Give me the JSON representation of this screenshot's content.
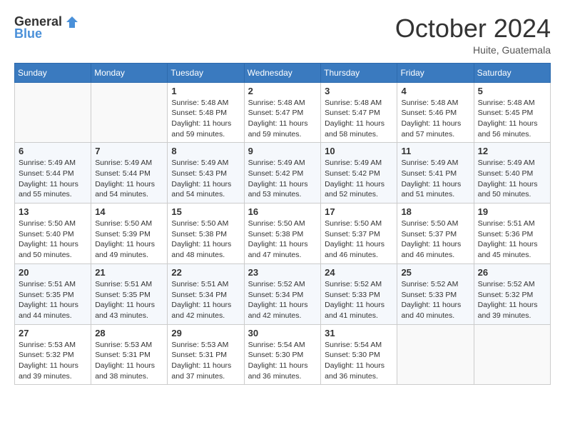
{
  "header": {
    "logo_general": "General",
    "logo_blue": "Blue",
    "month_title": "October 2024",
    "location": "Huite, Guatemala"
  },
  "weekdays": [
    "Sunday",
    "Monday",
    "Tuesday",
    "Wednesday",
    "Thursday",
    "Friday",
    "Saturday"
  ],
  "weeks": [
    [
      {
        "day": "",
        "info": ""
      },
      {
        "day": "",
        "info": ""
      },
      {
        "day": "1",
        "info": "Sunrise: 5:48 AM\nSunset: 5:48 PM\nDaylight: 11 hours and 59 minutes."
      },
      {
        "day": "2",
        "info": "Sunrise: 5:48 AM\nSunset: 5:47 PM\nDaylight: 11 hours and 59 minutes."
      },
      {
        "day": "3",
        "info": "Sunrise: 5:48 AM\nSunset: 5:47 PM\nDaylight: 11 hours and 58 minutes."
      },
      {
        "day": "4",
        "info": "Sunrise: 5:48 AM\nSunset: 5:46 PM\nDaylight: 11 hours and 57 minutes."
      },
      {
        "day": "5",
        "info": "Sunrise: 5:48 AM\nSunset: 5:45 PM\nDaylight: 11 hours and 56 minutes."
      }
    ],
    [
      {
        "day": "6",
        "info": "Sunrise: 5:49 AM\nSunset: 5:44 PM\nDaylight: 11 hours and 55 minutes."
      },
      {
        "day": "7",
        "info": "Sunrise: 5:49 AM\nSunset: 5:44 PM\nDaylight: 11 hours and 54 minutes."
      },
      {
        "day": "8",
        "info": "Sunrise: 5:49 AM\nSunset: 5:43 PM\nDaylight: 11 hours and 54 minutes."
      },
      {
        "day": "9",
        "info": "Sunrise: 5:49 AM\nSunset: 5:42 PM\nDaylight: 11 hours and 53 minutes."
      },
      {
        "day": "10",
        "info": "Sunrise: 5:49 AM\nSunset: 5:42 PM\nDaylight: 11 hours and 52 minutes."
      },
      {
        "day": "11",
        "info": "Sunrise: 5:49 AM\nSunset: 5:41 PM\nDaylight: 11 hours and 51 minutes."
      },
      {
        "day": "12",
        "info": "Sunrise: 5:49 AM\nSunset: 5:40 PM\nDaylight: 11 hours and 50 minutes."
      }
    ],
    [
      {
        "day": "13",
        "info": "Sunrise: 5:50 AM\nSunset: 5:40 PM\nDaylight: 11 hours and 50 minutes."
      },
      {
        "day": "14",
        "info": "Sunrise: 5:50 AM\nSunset: 5:39 PM\nDaylight: 11 hours and 49 minutes."
      },
      {
        "day": "15",
        "info": "Sunrise: 5:50 AM\nSunset: 5:38 PM\nDaylight: 11 hours and 48 minutes."
      },
      {
        "day": "16",
        "info": "Sunrise: 5:50 AM\nSunset: 5:38 PM\nDaylight: 11 hours and 47 minutes."
      },
      {
        "day": "17",
        "info": "Sunrise: 5:50 AM\nSunset: 5:37 PM\nDaylight: 11 hours and 46 minutes."
      },
      {
        "day": "18",
        "info": "Sunrise: 5:50 AM\nSunset: 5:37 PM\nDaylight: 11 hours and 46 minutes."
      },
      {
        "day": "19",
        "info": "Sunrise: 5:51 AM\nSunset: 5:36 PM\nDaylight: 11 hours and 45 minutes."
      }
    ],
    [
      {
        "day": "20",
        "info": "Sunrise: 5:51 AM\nSunset: 5:35 PM\nDaylight: 11 hours and 44 minutes."
      },
      {
        "day": "21",
        "info": "Sunrise: 5:51 AM\nSunset: 5:35 PM\nDaylight: 11 hours and 43 minutes."
      },
      {
        "day": "22",
        "info": "Sunrise: 5:51 AM\nSunset: 5:34 PM\nDaylight: 11 hours and 42 minutes."
      },
      {
        "day": "23",
        "info": "Sunrise: 5:52 AM\nSunset: 5:34 PM\nDaylight: 11 hours and 42 minutes."
      },
      {
        "day": "24",
        "info": "Sunrise: 5:52 AM\nSunset: 5:33 PM\nDaylight: 11 hours and 41 minutes."
      },
      {
        "day": "25",
        "info": "Sunrise: 5:52 AM\nSunset: 5:33 PM\nDaylight: 11 hours and 40 minutes."
      },
      {
        "day": "26",
        "info": "Sunrise: 5:52 AM\nSunset: 5:32 PM\nDaylight: 11 hours and 39 minutes."
      }
    ],
    [
      {
        "day": "27",
        "info": "Sunrise: 5:53 AM\nSunset: 5:32 PM\nDaylight: 11 hours and 39 minutes."
      },
      {
        "day": "28",
        "info": "Sunrise: 5:53 AM\nSunset: 5:31 PM\nDaylight: 11 hours and 38 minutes."
      },
      {
        "day": "29",
        "info": "Sunrise: 5:53 AM\nSunset: 5:31 PM\nDaylight: 11 hours and 37 minutes."
      },
      {
        "day": "30",
        "info": "Sunrise: 5:54 AM\nSunset: 5:30 PM\nDaylight: 11 hours and 36 minutes."
      },
      {
        "day": "31",
        "info": "Sunrise: 5:54 AM\nSunset: 5:30 PM\nDaylight: 11 hours and 36 minutes."
      },
      {
        "day": "",
        "info": ""
      },
      {
        "day": "",
        "info": ""
      }
    ]
  ]
}
